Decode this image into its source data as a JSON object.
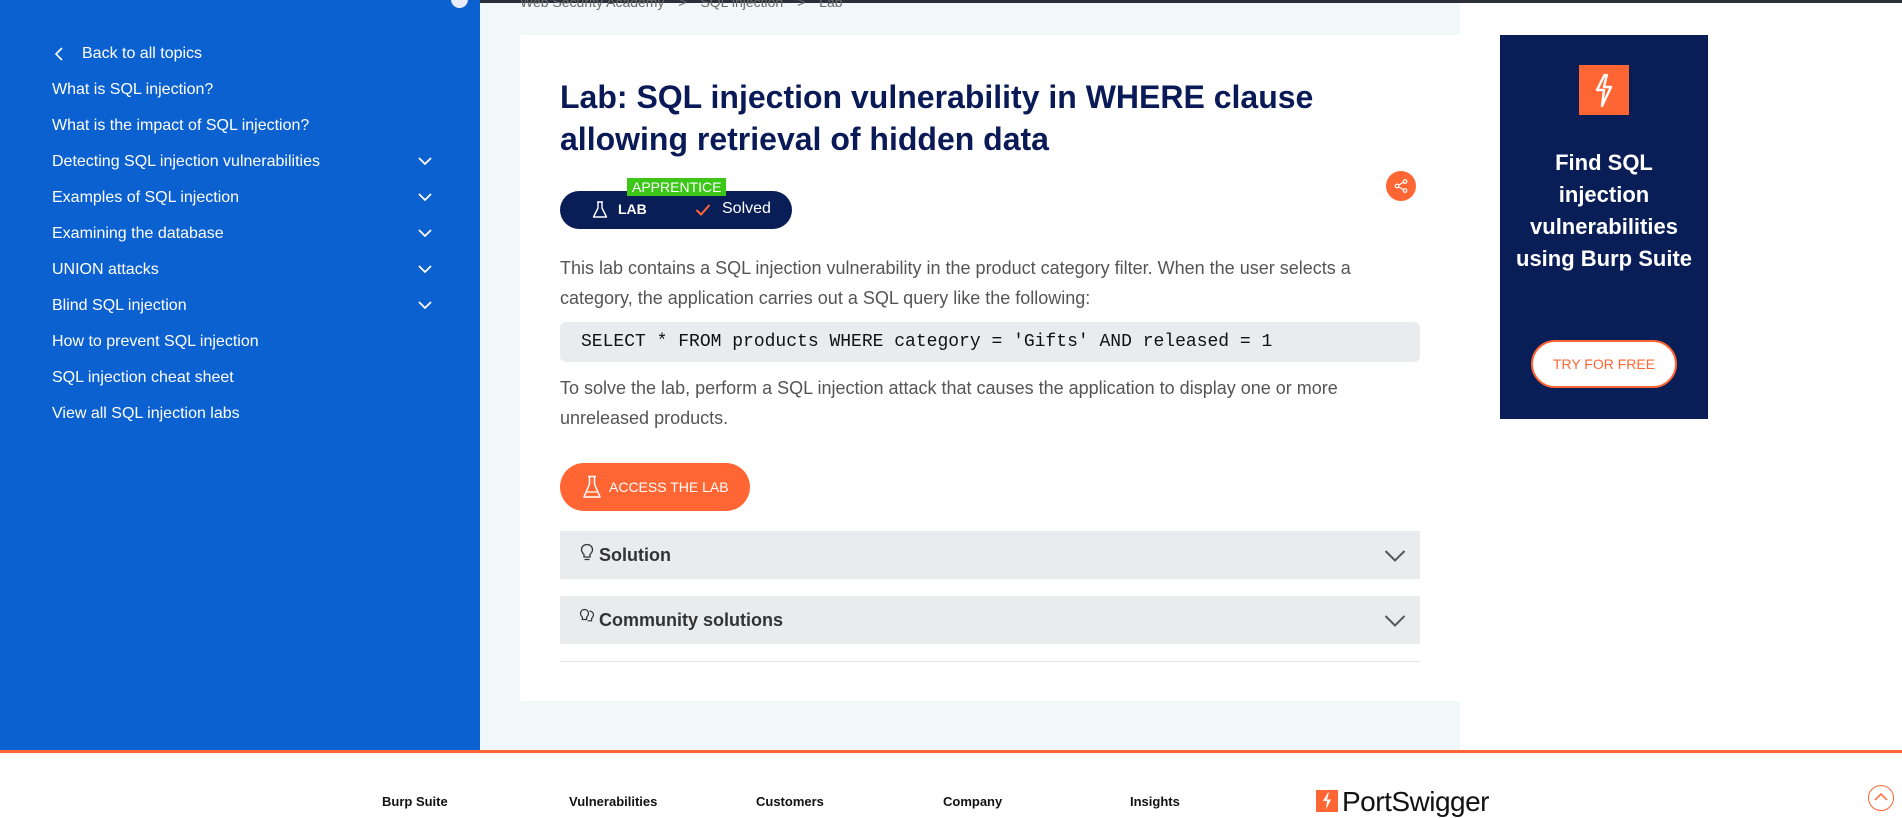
{
  "breadcrumb": [
    "Web Security Academy",
    ">",
    "SQL injection",
    ">",
    "Lab"
  ],
  "sidebar": {
    "back_label": "Back to all topics",
    "items": [
      {
        "label": "What is SQL injection?",
        "expandable": false
      },
      {
        "label": "What is the impact of SQL injection?",
        "expandable": false
      },
      {
        "label": "Detecting SQL injection vulnerabilities",
        "expandable": true
      },
      {
        "label": "Examples of SQL injection",
        "expandable": true
      },
      {
        "label": "Examining the database",
        "expandable": true
      },
      {
        "label": "UNION attacks",
        "expandable": true
      },
      {
        "label": "Blind SQL injection",
        "expandable": true
      },
      {
        "label": "How to prevent SQL injection",
        "expandable": false
      },
      {
        "label": "SQL injection cheat sheet",
        "expandable": false
      },
      {
        "label": "View all SQL injection labs",
        "expandable": false
      }
    ]
  },
  "lab": {
    "title": "Lab: SQL injection vulnerability in WHERE clause allowing retrieval of hidden data",
    "level_badge": "APPRENTICE",
    "lab_label": "LAB",
    "status": "Solved",
    "description": "This lab contains a SQL injection vulnerability in the product category filter. When the user selects a category, the application carries out a SQL query like the following:",
    "code": "SELECT * FROM products WHERE category = 'Gifts' AND released = 1",
    "instructions": "To solve the lab, perform a SQL injection attack that causes the application to display one or more unreleased products.",
    "access_button": "ACCESS THE LAB",
    "accordions": [
      {
        "label": "Solution",
        "icon": "lightbulb-icon"
      },
      {
        "label": "Community solutions",
        "icon": "community-bulbs-icon"
      }
    ]
  },
  "ad": {
    "heading": "Find SQL injection vulnerabilities using Burp Suite",
    "button": "TRY FOR FREE"
  },
  "footer": {
    "columns": [
      "Burp Suite",
      "Vulnerabilities",
      "Customers",
      "Company",
      "Insights"
    ],
    "brand": "PortSwigger"
  },
  "colors": {
    "sidebar": "#0c61d0",
    "accent": "#ff6633",
    "navy": "#091d56",
    "badge_green": "#3cc618"
  }
}
